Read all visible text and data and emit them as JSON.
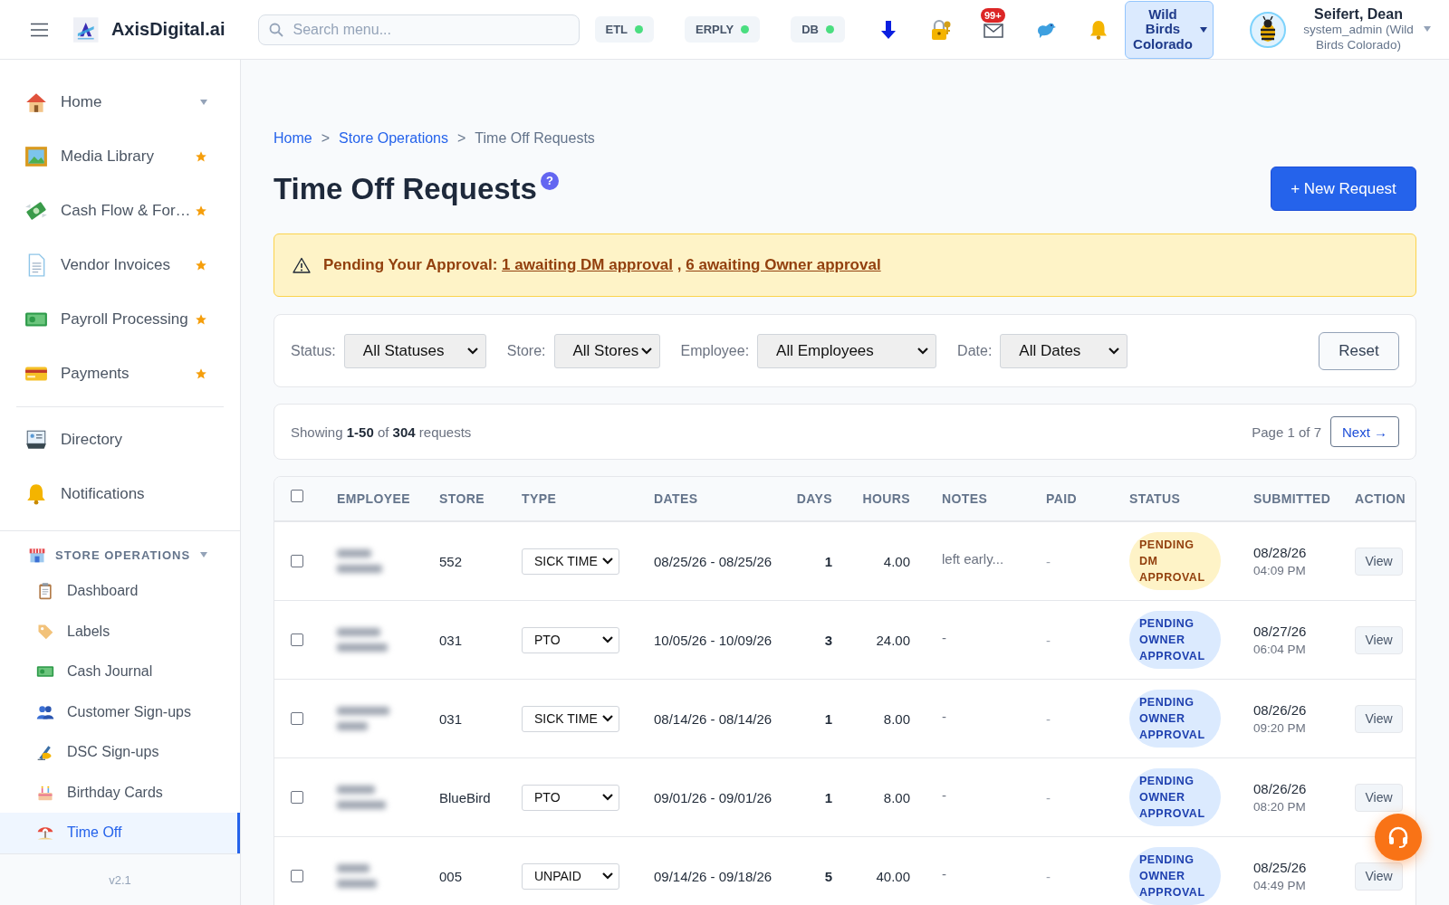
{
  "topbar": {
    "brand": "AxisDigital.ai",
    "search": {
      "placeholder": "Search menu..."
    },
    "services": [
      {
        "label": "ETL"
      },
      {
        "label": "ERPLY"
      },
      {
        "label": "DB"
      }
    ],
    "mail_badge": "99+",
    "store_selector": {
      "label": "Wild Birds Colorado"
    },
    "user": {
      "name": "Seifert, Dean",
      "role": "system_admin (Wild Birds Colorado)"
    }
  },
  "sidebar": {
    "favorites": [
      {
        "label": "Home",
        "expandable": true,
        "favorite": false
      },
      {
        "label": "Media Library",
        "expandable": false,
        "favorite": true
      },
      {
        "label": "Cash Flow & For…",
        "expandable": false,
        "favorite": true
      },
      {
        "label": "Vendor Invoices",
        "expandable": false,
        "favorite": true
      },
      {
        "label": "Payroll Processing",
        "expandable": false,
        "favorite": true
      },
      {
        "label": "Payments",
        "expandable": false,
        "favorite": true
      }
    ],
    "items": [
      {
        "label": "Directory"
      },
      {
        "label": "Notifications"
      }
    ],
    "section": {
      "title": "STORE OPERATIONS",
      "expanded": true,
      "items": [
        {
          "label": "Dashboard",
          "selected": false
        },
        {
          "label": "Labels",
          "selected": false
        },
        {
          "label": "Cash Journal",
          "selected": false
        },
        {
          "label": "Customer Sign-ups",
          "selected": false
        },
        {
          "label": "DSC Sign-ups",
          "selected": false
        },
        {
          "label": "Birthday Cards",
          "selected": false
        },
        {
          "label": "Time Off",
          "selected": true
        }
      ]
    },
    "version": "v2.1"
  },
  "breadcrumb": [
    {
      "kind": "link",
      "label": "Home"
    },
    {
      "kind": "separator",
      "label": ">"
    },
    {
      "kind": "link",
      "label": "Store Operations"
    },
    {
      "kind": "separator",
      "label": ">"
    },
    {
      "kind": "current",
      "label": "Time Off Requests"
    }
  ],
  "title": "Time Off Requests",
  "help_badge": "?",
  "new_button": "+ New Request",
  "alert": {
    "label": "Pending Your Approval:",
    "links": [
      "1 awaiting DM approval",
      "6 awaiting Owner approval"
    ],
    "separator": ","
  },
  "filters": [
    {
      "label": "Status:",
      "value": "All Statuses"
    },
    {
      "label": "Store:",
      "value": "All Stores"
    },
    {
      "label": "Employee:",
      "value": "All Employees"
    },
    {
      "label": "Date:",
      "value": "All Dates"
    }
  ],
  "reset": "Reset",
  "summary": {
    "text": "Showing **1-50** of **304** requests",
    "page": "Page 1 of 7",
    "next": "Next →"
  },
  "table": {
    "all_checked": false,
    "columns": [
      "EMPLOYEE",
      "STORE",
      "TYPE",
      "DATES",
      "DAYS",
      "HOURS",
      "NOTES",
      "PAID",
      "STATUS",
      "SUBMITTED",
      "ACTION"
    ],
    "rows": [
      {
        "checked": false,
        "store": "552",
        "type": "SICK TIME",
        "dates": "08/25/26 - 08/25/26",
        "days": "1",
        "hours": "4.00",
        "notes": "left early...",
        "paid": "-",
        "status": {
          "text": "PENDING DM APPROVAL",
          "kind": "dm"
        },
        "submitted_date": "08/28/26",
        "submitted_time": "04:09 PM",
        "action": "View"
      },
      {
        "checked": false,
        "store": "031",
        "type": "PTO",
        "dates": "10/05/26 - 10/09/26",
        "days": "3",
        "hours": "24.00",
        "notes": "-",
        "paid": "-",
        "status": {
          "text": "PENDING OWNER APPROVAL",
          "kind": "owner"
        },
        "submitted_date": "08/27/26",
        "submitted_time": "06:04 PM",
        "action": "View"
      },
      {
        "checked": false,
        "store": "031",
        "type": "SICK TIME",
        "dates": "08/14/26 - 08/14/26",
        "days": "1",
        "hours": "8.00",
        "notes": "-",
        "paid": "-",
        "status": {
          "text": "PENDING OWNER APPROVAL",
          "kind": "owner"
        },
        "submitted_date": "08/26/26",
        "submitted_time": "09:20 PM",
        "action": "View"
      },
      {
        "checked": false,
        "store": "BlueBird",
        "type": "PTO",
        "dates": "09/01/26 - 09/01/26",
        "days": "1",
        "hours": "8.00",
        "notes": "-",
        "paid": "-",
        "status": {
          "text": "PENDING OWNER APPROVAL",
          "kind": "owner"
        },
        "submitted_date": "08/26/26",
        "submitted_time": "08:20 PM",
        "action": "View"
      },
      {
        "checked": false,
        "store": "005",
        "type": "UNPAID",
        "dates": "09/14/26 - 09/18/26",
        "days": "5",
        "hours": "40.00",
        "notes": "-",
        "paid": "-",
        "status": {
          "text": "PENDING OWNER APPROVAL",
          "kind": "owner"
        },
        "submitted_date": "08/25/26",
        "submitted_time": "04:49 PM",
        "action": "View"
      }
    ]
  }
}
